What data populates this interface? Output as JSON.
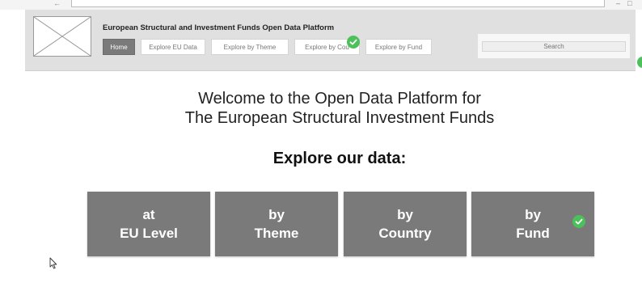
{
  "site_title": "European Structural and Investment Funds Open Data Platform",
  "nav": {
    "tabs": [
      {
        "label": "Home",
        "active": true
      },
      {
        "label": "Explore EU Data",
        "active": false
      },
      {
        "label": "Explore by Theme",
        "active": false
      },
      {
        "label": "Explore by Cou",
        "active": false
      },
      {
        "label": "Explore by Fund",
        "active": false
      }
    ]
  },
  "search": {
    "placeholder": "Search"
  },
  "welcome": {
    "line1": "Welcome to the Open Data Platform for",
    "line2": "The European Structural Investment Funds"
  },
  "explore_heading": "Explore our data:",
  "tiles": [
    {
      "line1": "at",
      "line2": "EU Level"
    },
    {
      "line1": "by",
      "line2": "Theme"
    },
    {
      "line1": "by",
      "line2": "Country"
    },
    {
      "line1": "by",
      "line2": "Fund"
    }
  ],
  "colors": {
    "tile_bg": "#7a7a7a",
    "header_bg": "#e0e0e0",
    "active_tab_bg": "#7a7a7a",
    "check_green": "#4cc05a"
  },
  "icons": {
    "logo_placeholder": "image-placeholder-icon",
    "check": "check-icon",
    "cursor": "mouse-pointer-icon"
  }
}
